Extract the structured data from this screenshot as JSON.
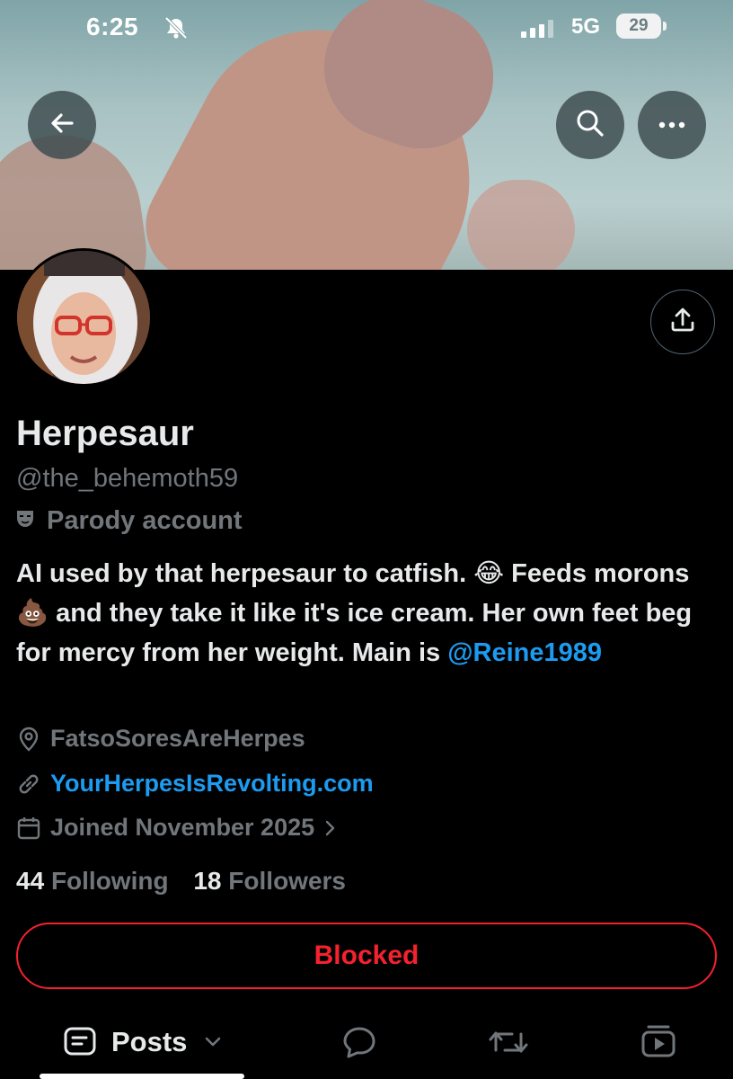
{
  "status_bar": {
    "time": "6:25",
    "network": "5G",
    "battery": "29"
  },
  "header": {
    "back_icon": "arrow-left-icon",
    "search_icon": "search-icon",
    "more_icon": "more-horizontal-icon"
  },
  "profile": {
    "display_name": "Herpesaur",
    "handle": "@the_behemoth59",
    "parody_label": "Parody account",
    "bio_parts": {
      "p1": "AI used by that herpesaur to catfish. ",
      "e1": "😂",
      "p2": " Feeds morons ",
      "e2": "💩",
      "p3": " and they take it like it's ice cream. Her own feet beg for mercy from her weight. Main is ",
      "mention": "@Reine1989"
    },
    "location": "FatsoSoresAreHerpes",
    "website": "YourHerpesIsRevolting.com",
    "joined": "Joined November 2025",
    "following_count": "44",
    "following_label": "Following",
    "followers_count": "18",
    "followers_label": "Followers",
    "blocked_label": "Blocked"
  },
  "tabs": {
    "posts_label": "Posts"
  },
  "colors": {
    "accent": "#1d9bf0",
    "blocked": "#f4212e",
    "muted": "#71767b"
  }
}
